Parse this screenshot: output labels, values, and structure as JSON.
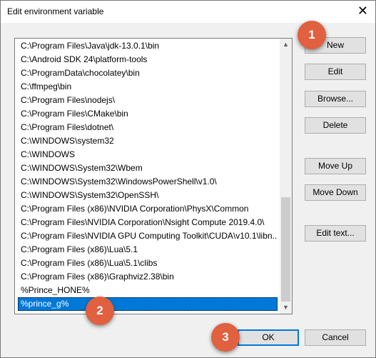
{
  "window": {
    "title": "Edit environment variable",
    "close_glyph": "✕"
  },
  "list": {
    "items": [
      "C:\\Program Files\\Java\\jdk-13.0.1\\bin",
      "C:\\Android SDK 24\\platform-tools",
      "C:\\ProgramData\\chocolatey\\bin",
      "C:\\ffmpeg\\bin",
      "C:\\Program Files\\nodejs\\",
      "C:\\Program Files\\CMake\\bin",
      "C:\\Program Files\\dotnet\\",
      "C:\\WINDOWS\\system32",
      "C:\\WINDOWS",
      "C:\\WINDOWS\\System32\\Wbem",
      "C:\\WINDOWS\\System32\\WindowsPowerShell\\v1.0\\",
      "C:\\WINDOWS\\System32\\OpenSSH\\",
      "C:\\Program Files (x86)\\NVIDIA Corporation\\PhysX\\Common",
      "C:\\Program Files\\NVIDIA Corporation\\Nsight Compute 2019.4.0\\",
      "C:\\Program Files\\NVIDIA GPU Computing Toolkit\\CUDA\\v10.1\\libn...",
      "C:\\Program Files (x86)\\Lua\\5.1",
      "C:\\Program Files (x86)\\Lua\\5.1\\clibs",
      "C:\\Program Files (x86)\\Graphviz2.38\\bin",
      "%Prince_HONE%",
      "%prince_g%"
    ],
    "selected_index": 19
  },
  "buttons": {
    "new": "New",
    "edit": "Edit",
    "browse": "Browse...",
    "delete": "Delete",
    "move_up": "Move Up",
    "move_down": "Move Down",
    "edit_text": "Edit text...",
    "ok": "OK",
    "cancel": "Cancel"
  },
  "badges": {
    "one": "1",
    "two": "2",
    "three": "3"
  },
  "colors": {
    "selection": "#0078d7",
    "badge": "#e0603f"
  }
}
